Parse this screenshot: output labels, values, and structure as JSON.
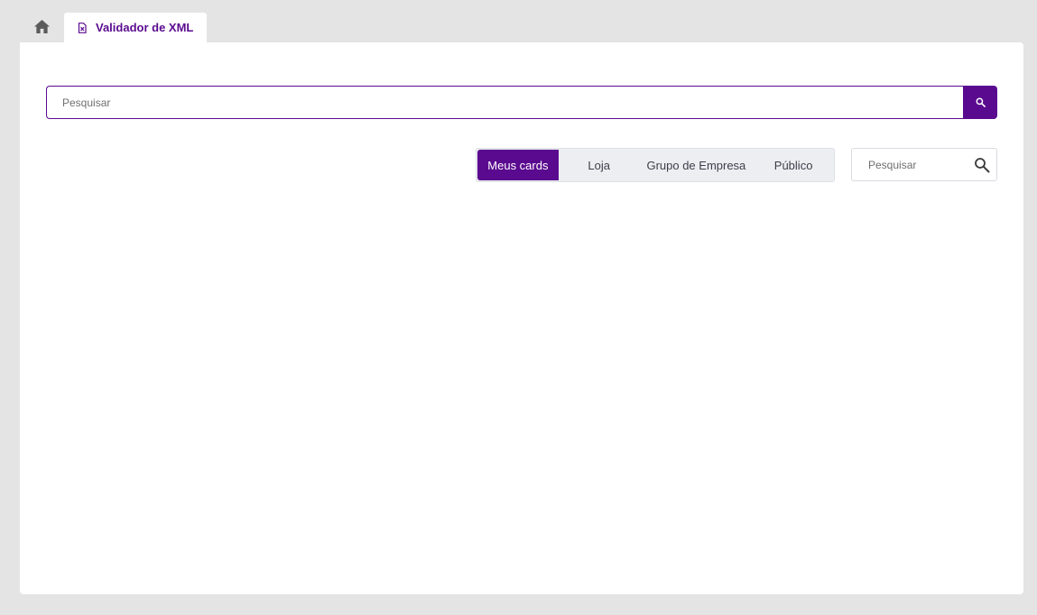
{
  "tabs": {
    "home_icon": "home-icon",
    "active_label": "Validador de XML",
    "active_icon": "xml-file-icon"
  },
  "main_search": {
    "placeholder": "Pesquisar",
    "button_icon": "search-icon"
  },
  "filters": {
    "items": [
      {
        "label": "Meus cards",
        "active": true
      },
      {
        "label": "Loja",
        "active": false
      },
      {
        "label": "Grupo de Empresa",
        "active": false
      },
      {
        "label": "Público",
        "active": false
      }
    ]
  },
  "card_search": {
    "placeholder": "Pesquisar",
    "icon": "search-icon"
  },
  "colors": {
    "accent": "#5a0a8f",
    "background": "#e4e4e4",
    "panel": "#ffffff",
    "filter_bg": "#eceef2"
  }
}
